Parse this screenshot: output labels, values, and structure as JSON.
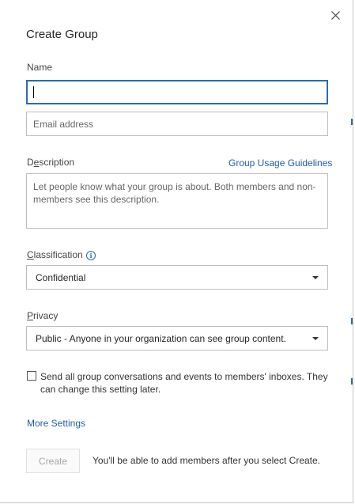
{
  "dialog": {
    "title": "Create Group",
    "close_label": "close"
  },
  "name": {
    "label": "Name",
    "value": "",
    "email_placeholder": "Email address"
  },
  "description": {
    "label_prefix": "D",
    "label_underlined": "e",
    "label_suffix": "scription",
    "guidelines_link": "Group Usage Guidelines",
    "placeholder": "Let people know what your group is about. Both members and non-members see this description."
  },
  "classification": {
    "label_underlined": "C",
    "label_suffix": "lassification",
    "info_icon": "info-icon",
    "info_glyph": "i",
    "selected": "Confidential"
  },
  "privacy": {
    "label_underlined": "P",
    "label_suffix": "rivacy",
    "selected": "Public - Anyone in your organization can see group content."
  },
  "subscribe": {
    "checked": false,
    "text": "Send all group conversations and events to members' inboxes. They can change this setting later."
  },
  "more_settings": "More Settings",
  "footer": {
    "create_label": "Create",
    "note": "You'll be able to add members after you select Create."
  },
  "colors": {
    "accent": "#2b6cb0",
    "link": "#1f5fa5",
    "disabled_text": "#a6a6a6",
    "border": "#bdbdbd"
  }
}
